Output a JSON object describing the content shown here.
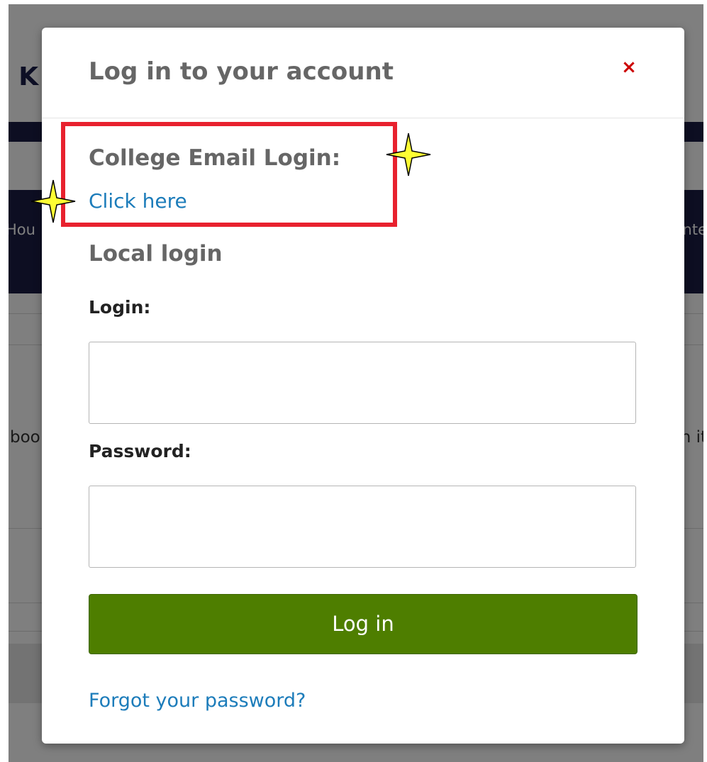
{
  "background": {
    "site_title_fragment": "· K",
    "nav_left_fragment": "Hou",
    "nav_right_fragment": "nte",
    "body_left_fragment": "boo",
    "body_right_fragment": "n it"
  },
  "modal": {
    "title": "Log in to your account",
    "close_label": "×",
    "college_section": {
      "heading": "College Email Login:",
      "link_label": "Click here"
    },
    "local_section": {
      "heading": "Local login",
      "login_label": "Login:",
      "login_value": "",
      "password_label": "Password:",
      "password_value": "",
      "submit_label": "Log in",
      "forgot_link": "Forgot your password?"
    }
  },
  "colors": {
    "accent_green": "#4e7e00",
    "link_blue": "#1c7cba",
    "close_red": "#cc0000",
    "highlight_red": "#e8212e",
    "sparkle_yellow": "#ffff33",
    "nav_dark": "#1b1d45"
  },
  "annotations": {
    "highlight": "red-rectangle",
    "markers": [
      "sparkle-icon",
      "sparkle-icon"
    ]
  }
}
